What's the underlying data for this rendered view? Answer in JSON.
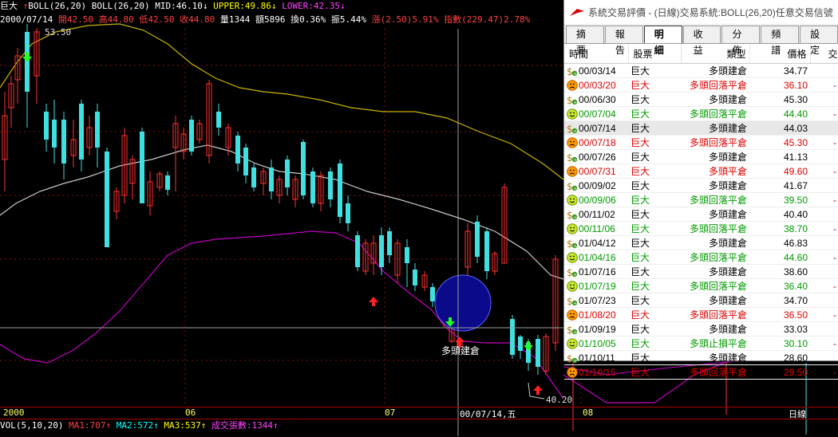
{
  "header": {
    "stock": "巨大",
    "indicator": "BOLL(26,20)",
    "indicator2": "BOLL(26,20)",
    "mid": "MID:46.10↓",
    "upper": "UPPER:49.86↓",
    "lower": "LOWER:42.35↓",
    "date": "2000/07/14",
    "open": "開42.50",
    "high": "高44.80",
    "low": "低42.50",
    "close": "收44.80",
    "volume": "量1344",
    "amount": "額5896",
    "turnover": "換0.36%",
    "amplitude": "振5.44%",
    "change": "漲(2.50)5.91%",
    "index": "指數(229.47)2.78%",
    "price_label": "53.50"
  },
  "annotations": {
    "signal_label": "多頭建倉",
    "low_label": "40.20"
  },
  "xaxis": {
    "labels": [
      "2000",
      "06",
      "07",
      "00/07/14,五",
      "08"
    ],
    "period": "日線"
  },
  "volume_bar": {
    "name": "VOL(5,10,20)",
    "ma1": "MA1:707↑",
    "ma2": "MA2:572↑",
    "ma3": "MA3:537↑",
    "volume": "成交張數:1344↑"
  },
  "window": {
    "title": "系統交易評價 - (日線)交易系統:BOLL(26,20)任意交易信號",
    "tabs": [
      "摘要",
      "報告",
      "明細",
      "收益",
      "分佈",
      "頻譜",
      "設定"
    ],
    "active_tab": "明細",
    "columns": [
      "時間",
      "股票",
      "類型",
      "價格",
      "交"
    ],
    "rows": [
      {
        "icon": "money",
        "date": "00/03/14",
        "stock": "巨大",
        "type": "多頭建倉",
        "price": "34.77",
        "color": "blk"
      },
      {
        "icon": "sad",
        "date": "00/03/20",
        "stock": "巨大",
        "type": "多頭回落平倉",
        "price": "36.10",
        "color": "red"
      },
      {
        "icon": "money",
        "date": "00/06/30",
        "stock": "巨大",
        "type": "多頭建倉",
        "price": "45.30",
        "color": "blk"
      },
      {
        "icon": "smile",
        "date": "00/07/04",
        "stock": "巨大",
        "type": "多頭回落平倉",
        "price": "44.40",
        "color": "grn"
      },
      {
        "icon": "money",
        "date": "00/07/14",
        "stock": "巨大",
        "type": "多頭建倉",
        "price": "44.03",
        "color": "blk"
      },
      {
        "icon": "sad",
        "date": "00/07/18",
        "stock": "巨大",
        "type": "多頭回落平倉",
        "price": "45.30",
        "color": "red"
      },
      {
        "icon": "money",
        "date": "00/07/26",
        "stock": "巨大",
        "type": "多頭建倉",
        "price": "41.13",
        "color": "blk"
      },
      {
        "icon": "sad",
        "date": "00/07/31",
        "stock": "巨大",
        "type": "多頭平倉",
        "price": "49.60",
        "color": "red"
      },
      {
        "icon": "money",
        "date": "00/09/02",
        "stock": "巨大",
        "type": "多頭建倉",
        "price": "41.67",
        "color": "blk"
      },
      {
        "icon": "smile",
        "date": "00/09/06",
        "stock": "巨大",
        "type": "多頭回落平倉",
        "price": "39.50",
        "color": "grn"
      },
      {
        "icon": "money",
        "date": "00/11/02",
        "stock": "巨大",
        "type": "多頭建倉",
        "price": "40.40",
        "color": "blk"
      },
      {
        "icon": "smile",
        "date": "00/11/06",
        "stock": "巨大",
        "type": "多頭回落平倉",
        "price": "38.70",
        "color": "grn"
      },
      {
        "icon": "money",
        "date": "01/04/12",
        "stock": "巨大",
        "type": "多頭建倉",
        "price": "46.83",
        "color": "blk"
      },
      {
        "icon": "smile",
        "date": "01/04/16",
        "stock": "巨大",
        "type": "多頭回落平倉",
        "price": "44.60",
        "color": "grn"
      },
      {
        "icon": "money",
        "date": "01/07/16",
        "stock": "巨大",
        "type": "多頭建倉",
        "price": "38.60",
        "color": "blk"
      },
      {
        "icon": "smile",
        "date": "01/07/19",
        "stock": "巨大",
        "type": "多頭回落平倉",
        "price": "36.40",
        "color": "grn"
      },
      {
        "icon": "money",
        "date": "01/07/23",
        "stock": "巨大",
        "type": "多頭建倉",
        "price": "34.70",
        "color": "blk"
      },
      {
        "icon": "sad",
        "date": "01/08/20",
        "stock": "巨大",
        "type": "多頭回落平倉",
        "price": "36.50",
        "color": "red"
      },
      {
        "icon": "money",
        "date": "01/09/19",
        "stock": "巨大",
        "type": "多頭建倉",
        "price": "33.03",
        "color": "blk"
      },
      {
        "icon": "smile",
        "date": "01/10/05",
        "stock": "巨大",
        "type": "多頭止損平倉",
        "price": "30.10",
        "color": "grn"
      },
      {
        "icon": "money",
        "date": "01/10/11",
        "stock": "巨大",
        "type": "多頭建倉",
        "price": "28.60",
        "color": "blk"
      },
      {
        "icon": "sad",
        "date": "01/10/15",
        "stock": "巨大",
        "type": "多頭回落平倉",
        "price": "29.50",
        "color": "red"
      }
    ]
  },
  "colors": {
    "upper": "#c8b400",
    "mid": "#c8c8c8",
    "lower": "#c000c0",
    "up_candle": "#ff3030",
    "down_candle": "#40e0e0",
    "highlight_circle": "#0a0a8a"
  }
}
